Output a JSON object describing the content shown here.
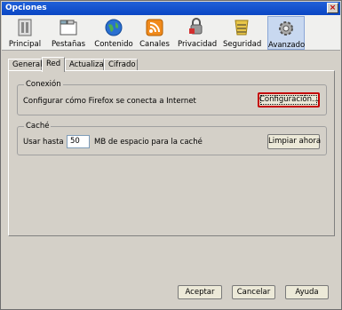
{
  "window": {
    "title": "Opciones",
    "close": "×"
  },
  "toolbar": {
    "items": [
      {
        "label": "Principal",
        "icon": "main-switch-icon"
      },
      {
        "label": "Pestañas",
        "icon": "tabs-window-icon"
      },
      {
        "label": "Contenido",
        "icon": "globe-icon"
      },
      {
        "label": "Canales",
        "icon": "rss-feed-icon"
      },
      {
        "label": "Privacidad",
        "icon": "privacy-mask-icon"
      },
      {
        "label": "Seguridad",
        "icon": "security-lock-icon"
      },
      {
        "label": "Avanzado",
        "icon": "gear-icon",
        "selected": true
      }
    ]
  },
  "tabs": [
    {
      "label": "General"
    },
    {
      "label": "Red",
      "active": true
    },
    {
      "label": "Actualizar"
    },
    {
      "label": "Cifrado"
    }
  ],
  "connection": {
    "title": "Conexión",
    "description": "Configurar cómo Firefox se conecta a Internet",
    "button": "Configuración..."
  },
  "cache": {
    "title": "Caché",
    "use_label": "Usar hasta",
    "value": "50",
    "suffix": "MB de espacio para la caché",
    "clear_button": "Limpiar ahora"
  },
  "footer": {
    "accept": "Aceptar",
    "cancel": "Cancelar",
    "help": "Ayuda"
  },
  "colors": {
    "titlebar": "#0a46c4",
    "focus_border": "#c40000"
  }
}
